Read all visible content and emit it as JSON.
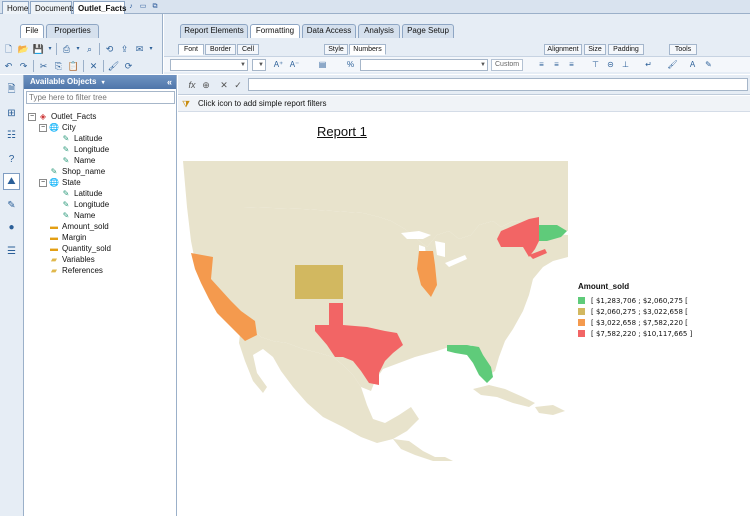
{
  "doc_tabs": [
    {
      "label": "Home"
    },
    {
      "label": "Documents"
    },
    {
      "label": "Outlet_Facts"
    }
  ],
  "left_tabs": [
    {
      "label": "File"
    },
    {
      "label": "Properties"
    }
  ],
  "ribbon_tabs": [
    {
      "label": "Report Elements"
    },
    {
      "label": "Formatting"
    },
    {
      "label": "Data Access"
    },
    {
      "label": "Analysis"
    },
    {
      "label": "Page Setup"
    }
  ],
  "subtabs": {
    "font": "Font",
    "border": "Border",
    "cell": "Cell",
    "style": "Style",
    "numbers": "Numbers",
    "alignment": "Alignment",
    "size": "Size",
    "padding": "Padding",
    "tools": "Tools"
  },
  "format_controls": {
    "custom_label": "Custom"
  },
  "panel": {
    "title": "Available Objects",
    "filter_placeholder": "Type here to filter tree"
  },
  "tree": [
    {
      "label": "Outlet_Facts"
    },
    {
      "label": "City"
    },
    {
      "label": "Latitude"
    },
    {
      "label": "Longitude"
    },
    {
      "label": "Name"
    },
    {
      "label": "Shop_name"
    },
    {
      "label": "State"
    },
    {
      "label": "Latitude"
    },
    {
      "label": "Longitude"
    },
    {
      "label": "Name"
    },
    {
      "label": "Amount_sold"
    },
    {
      "label": "Margin"
    },
    {
      "label": "Quantity_sold"
    },
    {
      "label": "Variables"
    },
    {
      "label": "References"
    }
  ],
  "filter_bar": {
    "text": "Click icon to add simple report filters"
  },
  "report": {
    "title": "Report 1"
  },
  "map": {
    "land_color": "#e8e3cc",
    "highlight_states": [
      {
        "state": "California",
        "color": "#f49a4e"
      },
      {
        "state": "Texas",
        "color": "#f26565"
      },
      {
        "state": "Colorado",
        "color": "#d2b860"
      },
      {
        "state": "Illinois",
        "color": "#f49a4e"
      },
      {
        "state": "New York",
        "color": "#f26565"
      },
      {
        "state": "Massachusetts",
        "color": "#5fcb7a"
      },
      {
        "state": "Florida",
        "color": "#5fcb7a"
      },
      {
        "state": "New Jersey",
        "color": "#f26565"
      }
    ]
  },
  "legend": {
    "title": "Amount_sold",
    "items": [
      {
        "label": "[ $1,283,706 ; $2,060,275 [",
        "color": "#5fcb7a"
      },
      {
        "label": "[ $2,060,275 ; $3,022,658 [",
        "color": "#d2b860"
      },
      {
        "label": "[ $3,022,658 ; $7,582,220 [",
        "color": "#f49a4e"
      },
      {
        "label": "[ $7,582,220 ; $10,117,665 ]",
        "color": "#f26565"
      }
    ]
  }
}
